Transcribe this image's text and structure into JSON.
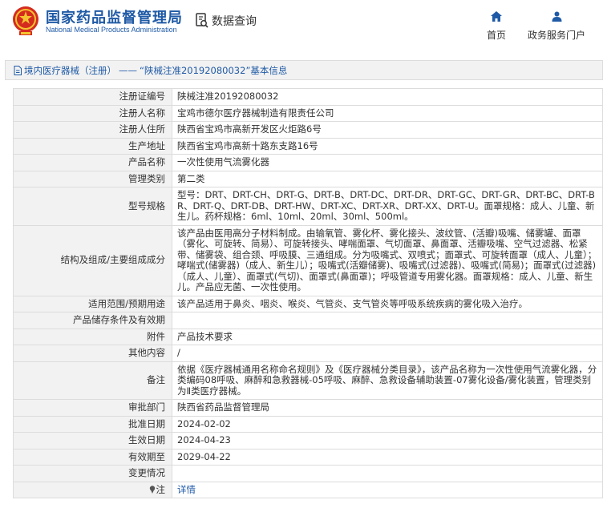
{
  "header": {
    "logo_cn": "国家药品监督管理局",
    "logo_en": "National Medical Products Administration",
    "search_label": "数据查询",
    "nav": {
      "home_label": "首页",
      "gov_label": "政务服务门户"
    },
    "accent_color": "#1f5aa6"
  },
  "breadcrumb": {
    "part1": "境内医疗器械（注册）",
    "separator": "——",
    "part2": "“陕械注准20192080032”基本信息"
  },
  "detail": {
    "reg_no": {
      "label": "注册证编号",
      "value": "陕械注准20192080032"
    },
    "registrant": {
      "label": "注册人名称",
      "value": "宝鸡市德尔医疗器械制造有限责任公司"
    },
    "registrant_address": {
      "label": "注册人住所",
      "value": "陕西省宝鸡市高新开发区火炬路6号"
    },
    "production_address": {
      "label": "生产地址",
      "value": "陕西省宝鸡市高新十路东支路16号"
    },
    "product_name": {
      "label": "产品名称",
      "value": "一次性使用气流雾化器"
    },
    "mgmt_class": {
      "label": "管理类别",
      "value": "第二类"
    },
    "model_spec": {
      "label": "型号规格",
      "value": "型号：DRT、DRT-CH、DRT-G、DRT-B、DRT-DC、DRT-DR、DRT-GC、DRT-GR、DRT-BC、DRT-BR、DRT-Q、DRT-DB、DRT-HW、DRT-XC、DRT-XR、DRT-XX、DRT-U。面罩规格：成人、儿童、新生儿。药杯规格：6ml、10ml、20ml、30ml、500ml。"
    },
    "structure": {
      "label": "结构及组成/主要组成成分",
      "value": "该产品由医用高分子材料制成。由输氧管、雾化杯、雾化接头、波纹管、(活瓣)吸嘴、储雾罐、面罩（雾化、可旋转、简易）、可旋转接头、哮喘面罩、气切面罩、鼻面罩、活瓣吸嘴、空气过滤器、松紧带、储雾袋、组合颈、呼吸膜、三通组成。分为吸嘴式、双喷式；面罩式、可旋转面罩（成人、儿童）；哮喘式(储雾器)（成人、新生儿）；吸嘴式(活瓣储雾)、吸嘴式(过滤器)、吸嘴式(简易)；面罩式(过滤器)（成人、儿童）、面罩式(气切)、面罩式(鼻面罩)；呼吸管道专用雾化器。面罩规格：成人、儿童、新生儿。产品应无菌、一次性使用。"
    },
    "intended_use": {
      "label": "适用范围/预期用途",
      "value": "该产品适用于鼻炎、咽炎、喉炎、气管炎、支气管炎等呼吸系统疾病的雾化吸入治疗。"
    },
    "storage": {
      "label": "产品储存条件及有效期",
      "value": ""
    },
    "attachment": {
      "label": "附件",
      "value": "产品技术要求"
    },
    "other": {
      "label": "其他内容",
      "value": "/"
    },
    "remark": {
      "label": "备注",
      "value": "依据《医疗器械通用名称命名规则》及《医疗器械分类目录》，该产品名称为一次性使用气流雾化器，分类编码08呼吸、麻醉和急救器械-05呼吸、麻醉、急救设备辅助装置-07雾化设备/雾化装置，管理类别为Ⅱ类医疗器械。"
    },
    "approval_dept": {
      "label": "审批部门",
      "value": "陕西省药品监督管理局"
    },
    "approval_date": {
      "label": "批准日期",
      "value": "2024-02-02"
    },
    "effective_date": {
      "label": "生效日期",
      "value": "2024-04-23"
    },
    "expiry_date": {
      "label": "有效期至",
      "value": "2029-04-22"
    },
    "change": {
      "label": "变更情况",
      "value": ""
    },
    "note": {
      "label": "注",
      "link": "详情"
    }
  }
}
